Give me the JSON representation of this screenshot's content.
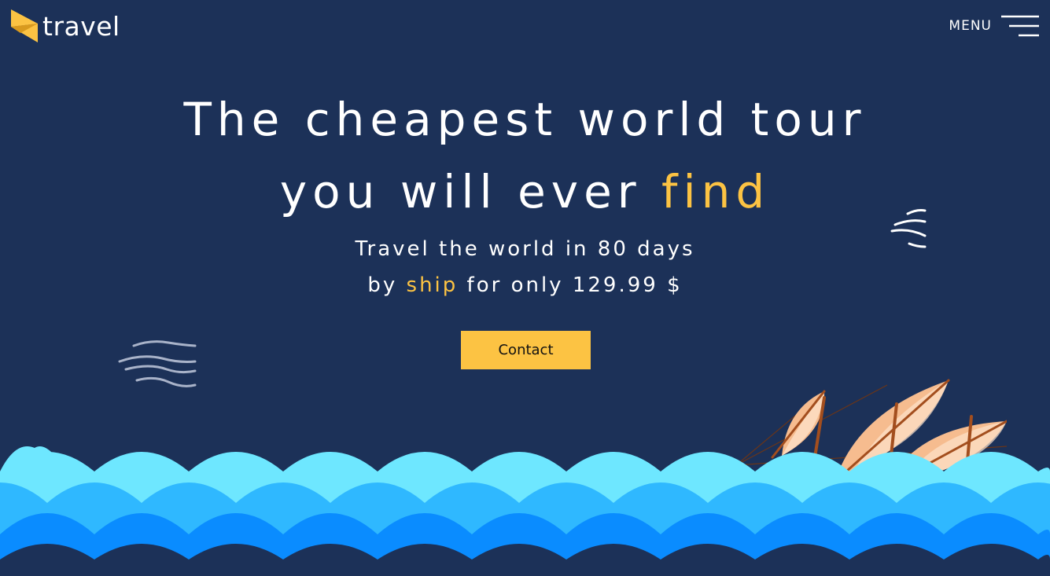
{
  "logo": {
    "text": "travel",
    "icon": "paper-plane-logo-icon"
  },
  "menu": {
    "label": "MENU",
    "icon": "hamburger-menu-icon"
  },
  "hero": {
    "title_line1": "The cheapest world tour",
    "title_line2_pre": "you will ever ",
    "title_line2_accent": "find",
    "sub_line1": "Travel the world in 80 days",
    "sub_line2_pre": "by ",
    "sub_line2_accent": "ship",
    "sub_line2_post": " for only 129.99 $"
  },
  "cta": {
    "label": "Contact"
  },
  "decor": [
    "wind-icon",
    "sailing-ship-illustration",
    "ocean-waves"
  ],
  "colors": {
    "background": "#1c3158",
    "accent": "#fcc343",
    "wave_light": "#6ee7ff",
    "wave_mid": "#2fb8ff",
    "wave_dark": "#0a8cff"
  }
}
